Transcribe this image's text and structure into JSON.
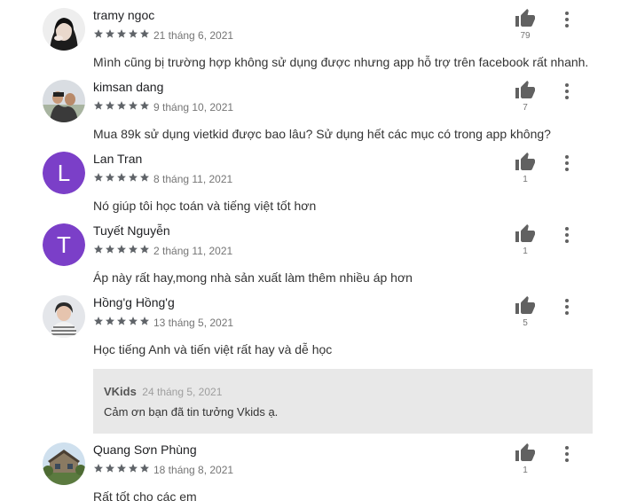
{
  "colors": {
    "star": "#5f6368",
    "avatar_purple": "#7b3fc8",
    "reply_bg": "#e8e8e8",
    "thumb": "#616161"
  },
  "reviews": [
    {
      "name": "tramy ngoc",
      "rating": 5,
      "date": "21 tháng 6, 2021",
      "text": "Mình cũng bị trường hợp không sử dụng được nhưng app hỗ trợ trên facebook rất nhanh.",
      "helpful": "79",
      "avatar": "photo"
    },
    {
      "name": "kimsan dang",
      "rating": 5,
      "date": "9 tháng 10, 2021",
      "text": "Mua 89k sử dụng vietkid được bao lâu? Sử dụng hết các mục có trong app không?",
      "helpful": "7",
      "avatar": "photo"
    },
    {
      "name": "Lan Tran",
      "rating": 5,
      "date": "8 tháng 11, 2021",
      "text": "Nó giúp tôi học toán và tiếng việt tốt hơn",
      "helpful": "1",
      "avatar": "L"
    },
    {
      "name": "Tuyết Nguyễn",
      "rating": 5,
      "date": "2 tháng 11, 2021",
      "text": "Áp này rất hay,mong nhà sản xuất làm thêm nhiều áp hơn",
      "helpful": "1",
      "avatar": "T"
    },
    {
      "name": "Hồng'g Hồng'g",
      "rating": 5,
      "date": "13 tháng 5, 2021",
      "text": "Học tiếng Anh và tiến việt rất hay và dễ học",
      "helpful": "5",
      "avatar": "photo"
    },
    {
      "name": "Quang Sơn Phùng",
      "rating": 5,
      "date": "18 tháng 8, 2021",
      "text": "Rất tốt cho các em",
      "helpful": "1",
      "avatar": "photo"
    }
  ],
  "reply": {
    "name": "VKids",
    "date": "24 tháng 5, 2021",
    "text": "Cảm ơn bạn đã tin tưởng Vkids ạ."
  }
}
